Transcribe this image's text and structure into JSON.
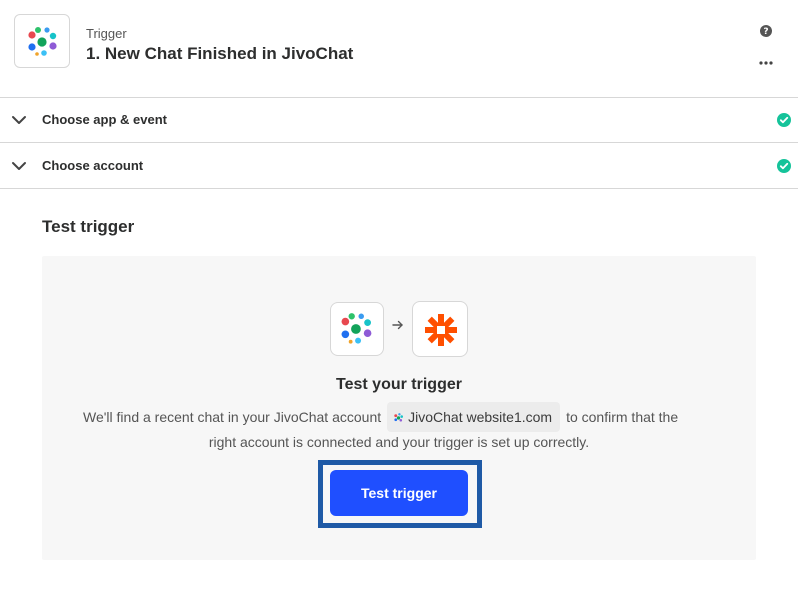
{
  "header": {
    "kicker": "Trigger",
    "title": "1. New Chat Finished in JivoChat",
    "app_icon": "jivochat-logo",
    "help_icon": "question-circle-icon",
    "more_icon": "ellipsis-icon"
  },
  "sections": [
    {
      "label": "Choose app & event",
      "status": "complete",
      "icon": "check-circle-icon"
    },
    {
      "label": "Choose account",
      "status": "complete",
      "icon": "check-circle-icon"
    }
  ],
  "test": {
    "heading": "Test trigger",
    "panel_title": "Test your trigger",
    "description_before": "We'll find a recent chat in your JivoChat account",
    "account_name": "JivoChat website1.com",
    "description_after": "to confirm that the",
    "description_line2": "right account is connected and your trigger is set up correctly.",
    "button_label": "Test trigger",
    "source_icon": "jivochat-logo",
    "target_icon": "zapier-logo",
    "arrow_icon": "arrow-right-icon"
  },
  "colors": {
    "accent": "#1f4fff",
    "success": "#15c39a",
    "highlight_frame": "#1f5aa6",
    "zapier_orange": "#ff4f00",
    "panel_bg": "#f7f7f7"
  }
}
